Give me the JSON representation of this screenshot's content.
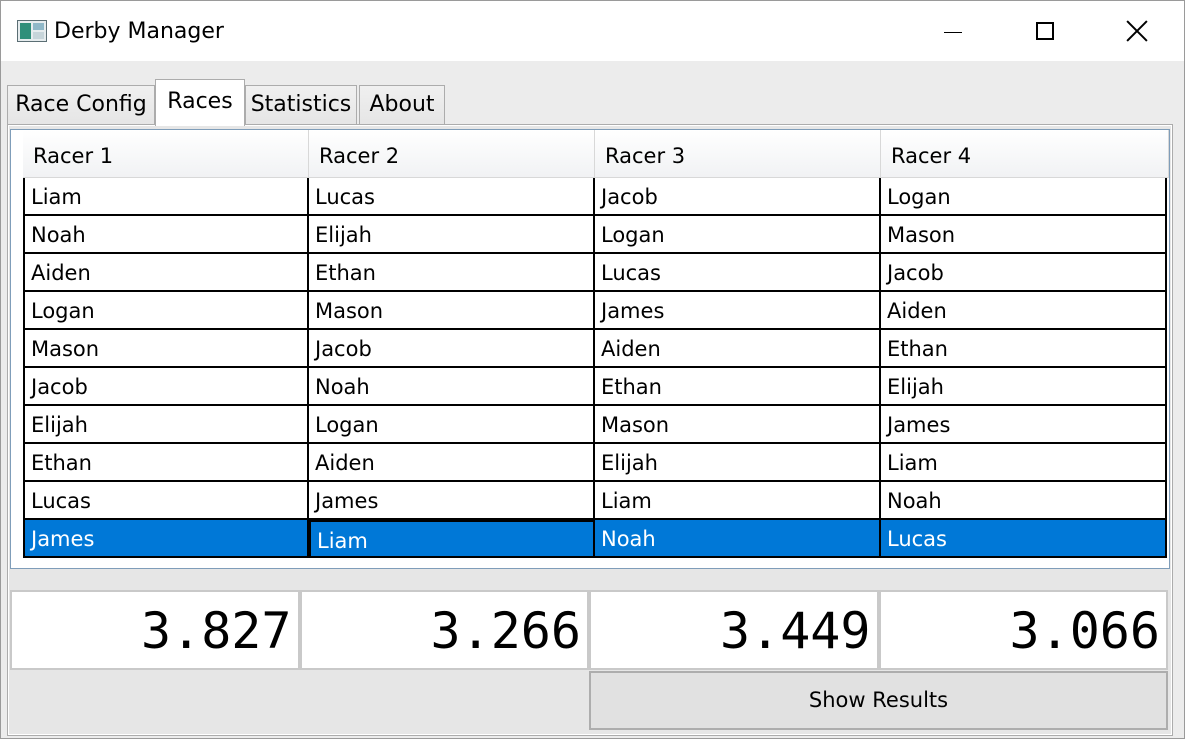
{
  "window": {
    "title": "Derby Manager",
    "icon": "app-icon"
  },
  "tabs": [
    {
      "label": "Race Config",
      "selected": false
    },
    {
      "label": "Races",
      "selected": true
    },
    {
      "label": "Statistics",
      "selected": false
    },
    {
      "label": "About",
      "selected": false
    }
  ],
  "grid": {
    "columns": [
      "Racer 1",
      "Racer 2",
      "Racer 3",
      "Racer 4"
    ],
    "rows": [
      [
        "Liam",
        "Lucas",
        "Jacob",
        "Logan"
      ],
      [
        "Noah",
        "Elijah",
        "Logan",
        "Mason"
      ],
      [
        "Aiden",
        "Ethan",
        "Lucas",
        "Jacob"
      ],
      [
        "Logan",
        "Mason",
        "James",
        "Aiden"
      ],
      [
        "Mason",
        "Jacob",
        "Aiden",
        "Ethan"
      ],
      [
        "Jacob",
        "Noah",
        "Ethan",
        "Elijah"
      ],
      [
        "Elijah",
        "Logan",
        "Mason",
        "James"
      ],
      [
        "Ethan",
        "Aiden",
        "Elijah",
        "Liam"
      ],
      [
        "Lucas",
        "James",
        "Liam",
        "Noah"
      ],
      [
        "James",
        "Liam",
        "Noah",
        "Lucas"
      ]
    ],
    "selected_row_index": 9,
    "selected_column_index": 1,
    "selection_color": "#0078d7"
  },
  "times": [
    "3.827",
    "3.266",
    "3.449",
    "3.066"
  ],
  "show_results_label": "Show Results"
}
